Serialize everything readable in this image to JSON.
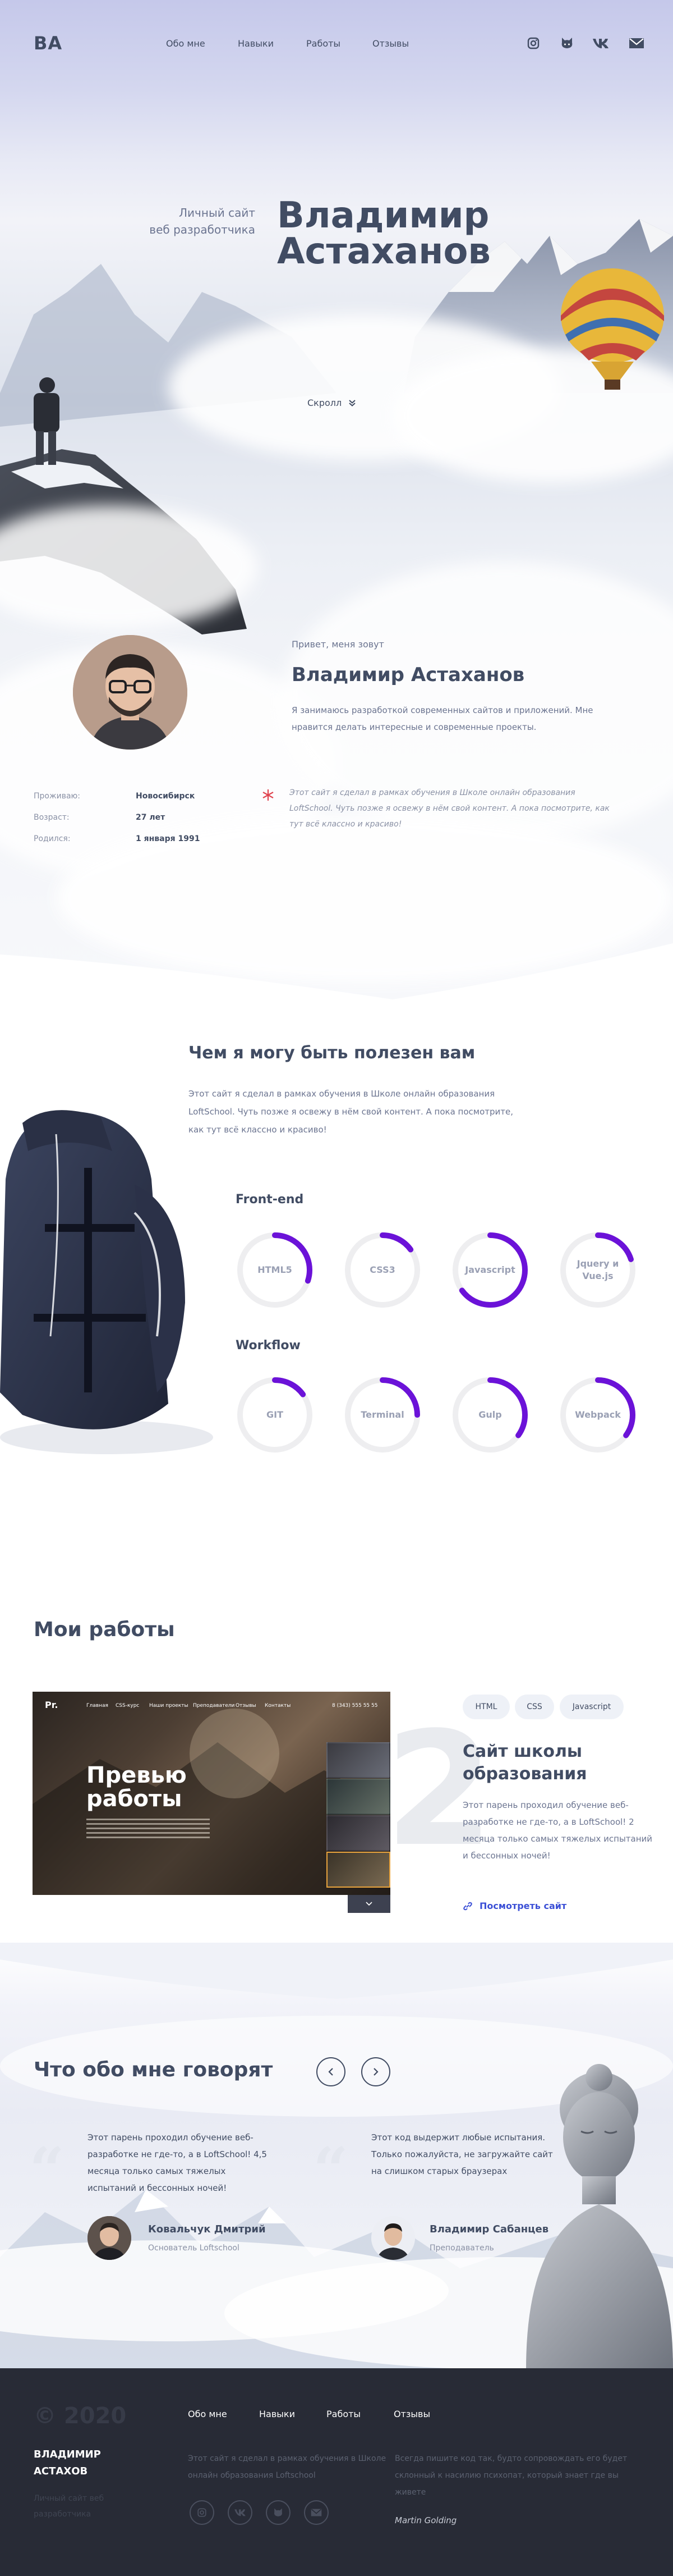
{
  "header": {
    "logo": "ВА",
    "nav": [
      "Обо мне",
      "Навыки",
      "Работы",
      "Отзывы"
    ],
    "social_icons": [
      "instagram-icon",
      "github-icon",
      "vk-icon",
      "mail-icon"
    ]
  },
  "hero": {
    "subtitle_line1": "Личный сайт",
    "subtitle_line2": "веб разработчика",
    "name_line1": "Владимир",
    "name_line2": "Астаханов",
    "scroll_label": "Скролл"
  },
  "about": {
    "hello": "Привет, меня зовут",
    "name": "Владимир Астаханов",
    "text": "Я занимаюсь разработкой современных сайтов и приложений. Мне нравится делать интересные и современные проекты.",
    "info": [
      {
        "key": "Проживаю:",
        "value": "Новосибирск"
      },
      {
        "key": "Возраст:",
        "value": "27 лет"
      },
      {
        "key": "Родился:",
        "value": "1 января 1991"
      }
    ],
    "quote": "Этот сайт я сделал в рамках обучения в Школе онлайн образования LoftSchool. Чуть позже я освежу в нём свой контент. А пока посмотрите, как тут всё классно и красиво!"
  },
  "skills": {
    "title": "Чем я могу быть полезен вам",
    "text": "Этот сайт я сделал в рамках обучения в Школе онлайн образования LoftSchool. Чуть позже я освежу в нём свой контент. А пока посмотрите, как тут всё классно и красиво!",
    "groups": [
      {
        "title": "Front-end",
        "items": [
          {
            "name": "HTML5",
            "level": 0.3
          },
          {
            "name": "CSS3",
            "level": 0.15
          },
          {
            "name": "Javascript",
            "level": 0.65
          },
          {
            "name": "Jquery и Vue.js",
            "level": 0.2
          }
        ]
      },
      {
        "title": "Workflow",
        "items": [
          {
            "name": "GIT",
            "level": 0.15
          },
          {
            "name": "Terminal",
            "level": 0.25
          },
          {
            "name": "Gulp",
            "level": 0.35
          },
          {
            "name": "Webpack",
            "level": 0.35
          }
        ]
      }
    ],
    "accent": "#6b12d8"
  },
  "works": {
    "title": "Мои работы",
    "preview": {
      "logo": "Pr.",
      "nav": [
        "Главная",
        "CSS-курс",
        "Наши проекты",
        "Преподаватели",
        "Отзывы",
        "Контакты"
      ],
      "phone": "8 (343) 555 55 55",
      "title_line1": "Превью",
      "title_line2": "работы"
    },
    "number": "2",
    "tags": [
      "HTML",
      "CSS",
      "Javascript"
    ],
    "name": "Сайт школы образования",
    "desc": "Этот парень проходил обучение веб-разработке не где-то, а в LoftSchool! 2 месяца только самых тяжелых испытаний и бессонных ночей!",
    "link": "Посмотреть сайт",
    "link_color": "#3b4fd6"
  },
  "reviews": {
    "title": "Что обо мне говорят",
    "items": [
      {
        "text": "Этот парень проходил обучение веб-разработке не где-то, а в LoftSchool! 4,5 месяца только самых тяжелых испытаний и бессонных ночей!",
        "name": "Ковальчук Дмитрий",
        "role": "Основатель Loftschool"
      },
      {
        "text": "Этот код выдержит любые испытания. Только пожалуйста, не загружайте сайт на слишком старых браузерах",
        "name": "Владимир Сабанцев",
        "role": "Преподаватель"
      }
    ]
  },
  "footer": {
    "year": "© 2020",
    "name": "ВЛАДИМИР АСТАХОВ",
    "sub": "Личный сайт веб разработчика",
    "nav": [
      "Обо мне",
      "Навыки",
      "Работы",
      "Отзывы"
    ],
    "text_left": "Этот сайт я сделал в рамках обучения в Школе онлайн образования Loftschool",
    "text_right": "Всегда пишите код так, будто сопровождать его будет склонный к насилию психопат, который знает где вы живете",
    "author": "Martin Golding",
    "social_icons": [
      "instagram-icon",
      "vk-icon",
      "github-icon",
      "mail-icon"
    ]
  }
}
